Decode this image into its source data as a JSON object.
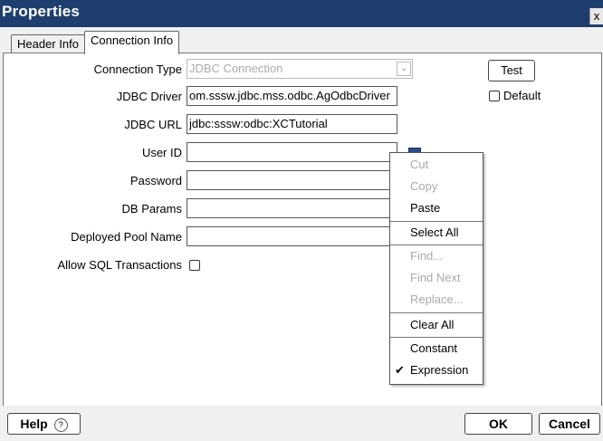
{
  "window": {
    "title": "Properties",
    "close_label": "x"
  },
  "tabs": [
    {
      "label": "Header Info"
    },
    {
      "label": "Connection Info"
    }
  ],
  "form": {
    "connection_type": {
      "label": "Connection Type",
      "value": "JDBC Connection"
    },
    "jdbc_driver": {
      "label": "JDBC Driver",
      "value": "om.sssw.jdbc.mss.odbc.AgOdbcDriver"
    },
    "jdbc_url": {
      "label": "JDBC URL",
      "value": "jdbc:sssw:odbc:XCTutorial"
    },
    "user_id": {
      "label": "User ID",
      "value": ""
    },
    "password": {
      "label": "Password",
      "value": ""
    },
    "db_params": {
      "label": "DB Params",
      "value": ""
    },
    "deployed_pool_name": {
      "label": "Deployed Pool Name",
      "value": ""
    },
    "allow_sql_transactions": {
      "label": "Allow SQL Transactions",
      "checked": false
    },
    "test_label": "Test",
    "default": {
      "label": "Default",
      "checked": false
    }
  },
  "context_menu": {
    "items": [
      {
        "label": "Cut",
        "enabled": false
      },
      {
        "label": "Copy",
        "enabled": false
      },
      {
        "label": "Paste",
        "enabled": true
      },
      {
        "label": "Select All",
        "enabled": true
      },
      {
        "label": "Find...",
        "enabled": false
      },
      {
        "label": "Find Next",
        "enabled": false
      },
      {
        "label": "Replace...",
        "enabled": false
      },
      {
        "label": "Clear All",
        "enabled": true
      },
      {
        "label": "Constant",
        "enabled": true
      },
      {
        "label": "Expression",
        "enabled": true,
        "checked": true
      }
    ]
  },
  "footer": {
    "help_label": "Help",
    "help_icon": "?",
    "ok_label": "OK",
    "cancel_label": "Cancel"
  },
  "colors": {
    "titlebar": "#1e3f6e"
  }
}
